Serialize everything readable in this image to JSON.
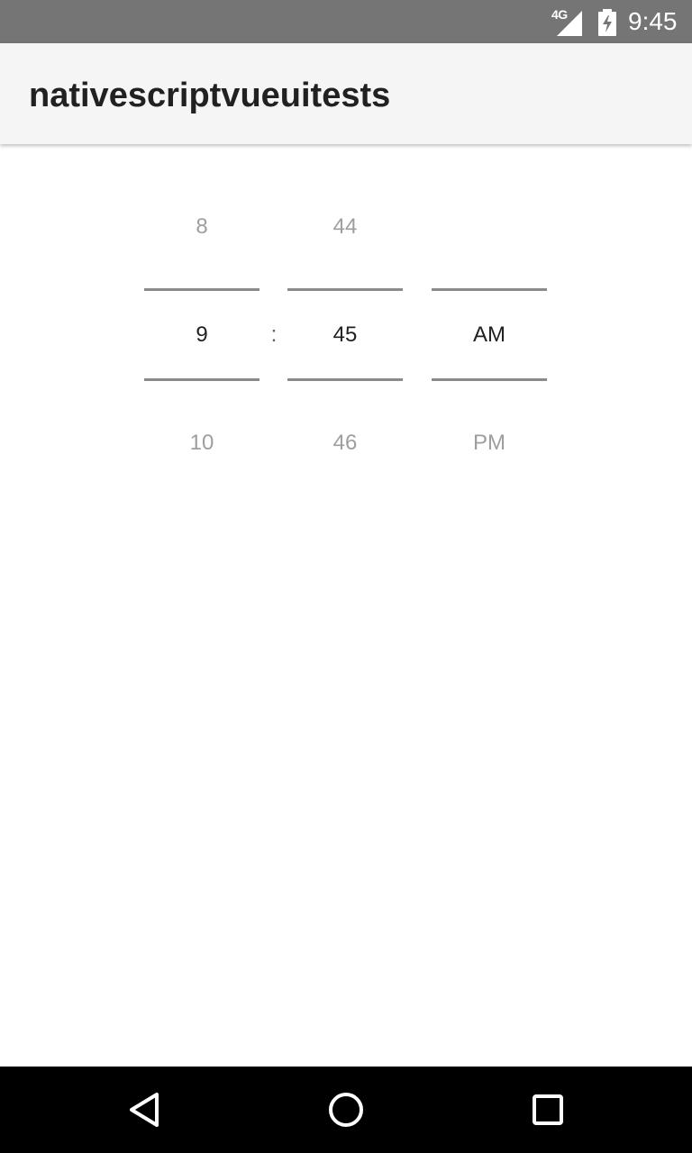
{
  "status_bar": {
    "network": "4G",
    "time": "9:45",
    "icons": [
      "signal-icon",
      "battery-charging-icon"
    ],
    "background": "#757575"
  },
  "action_bar": {
    "title": "nativescriptvueuitests",
    "background": "#f5f5f5"
  },
  "time_picker": {
    "separator": ":",
    "hour": {
      "prev": "8",
      "current": "9",
      "next": "10"
    },
    "minute": {
      "prev": "44",
      "current": "45",
      "next": "46"
    },
    "ampm": {
      "prev": "",
      "current": "AM",
      "next": "PM"
    },
    "colors": {
      "selected_text": "#212121",
      "dim_text": "#9e9e9e",
      "divider": "#8a8a8a"
    }
  },
  "nav_bar": {
    "buttons": [
      "back-icon",
      "home-icon",
      "recents-icon"
    ],
    "background": "#000000"
  }
}
